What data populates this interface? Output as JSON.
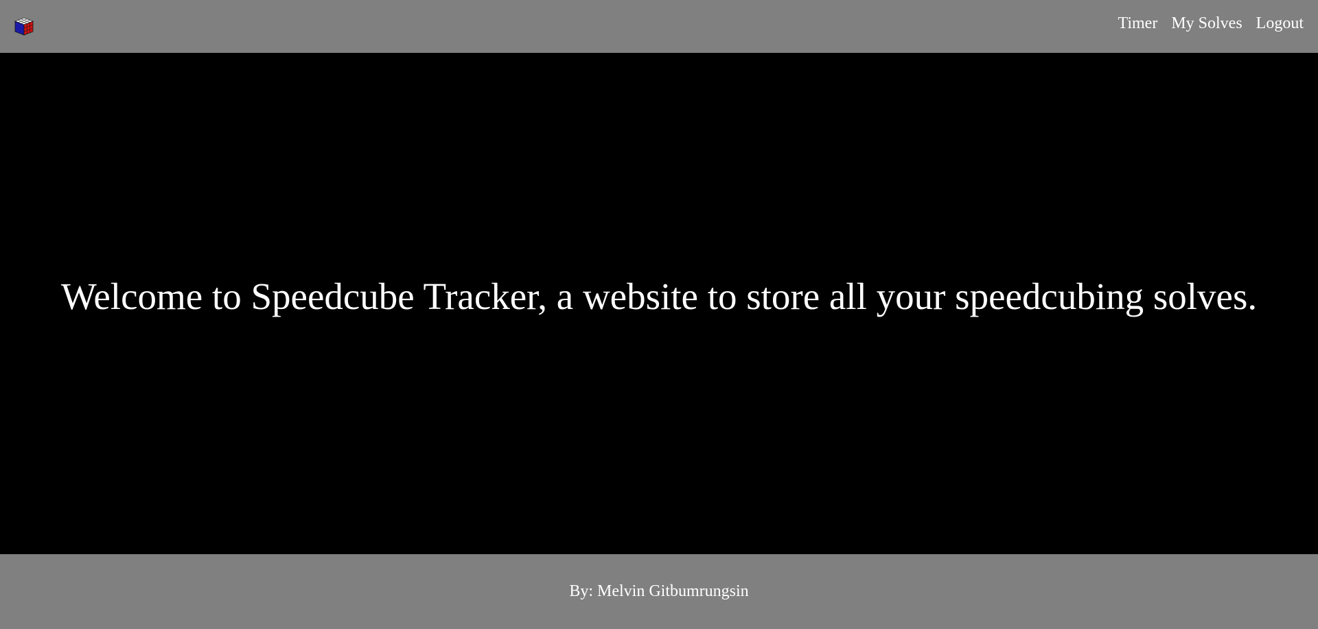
{
  "header": {
    "logo_icon": "rubiks-cube-icon",
    "nav": [
      {
        "label": "Timer"
      },
      {
        "label": "My Solves"
      },
      {
        "label": "Logout"
      }
    ]
  },
  "main": {
    "welcome_text": "Welcome to Speedcube Tracker, a website to store all your speedcubing solves."
  },
  "footer": {
    "credit": "By: Melvin Gitbumrungsin"
  },
  "colors": {
    "bar_background": "#808080",
    "main_background": "#000000",
    "text": "#ffffff",
    "cube_blue": "#1a1aa6",
    "cube_red": "#d21414",
    "cube_white": "#ffffff"
  }
}
